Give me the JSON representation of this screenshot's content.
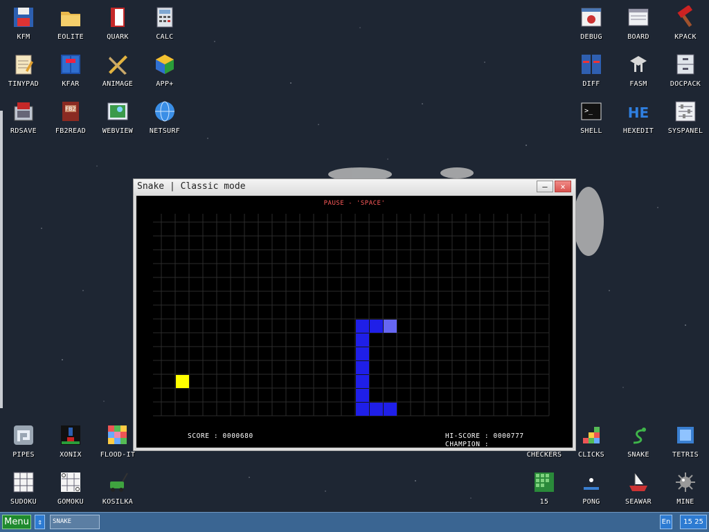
{
  "desktop": {
    "icons": [
      {
        "label": "KFM",
        "icon": "floppy-disk-icon"
      },
      {
        "label": "EOLITE",
        "icon": "folder-icon"
      },
      {
        "label": "QUARK",
        "icon": "red-book-icon"
      },
      {
        "label": "CALC",
        "icon": "calculator-icon"
      },
      {
        "label": "TINYPAD",
        "icon": "notepad-icon"
      },
      {
        "label": "KFAR",
        "icon": "file-manager-icon"
      },
      {
        "label": "ANIMAGE",
        "icon": "pencil-ruler-icon"
      },
      {
        "label": "APP+",
        "icon": "cube-icon"
      },
      {
        "label": "RDSAVE",
        "icon": "ramdisk-save-icon"
      },
      {
        "label": "FB2READ",
        "icon": "fb2-book-icon"
      },
      {
        "label": "WEBVIEW",
        "icon": "web-image-icon"
      },
      {
        "label": "NETSURF",
        "icon": "globe-icon"
      },
      {
        "label": "DEBUG",
        "icon": "bug-icon"
      },
      {
        "label": "BOARD",
        "icon": "board-window-icon"
      },
      {
        "label": "KPACK",
        "icon": "hammer-icon"
      },
      {
        "label": "DIFF",
        "icon": "diff-icon"
      },
      {
        "label": "FASM",
        "icon": "fasm-icon"
      },
      {
        "label": "DOCPACK",
        "icon": "drawer-icon"
      },
      {
        "label": "SHELL",
        "icon": "terminal-icon"
      },
      {
        "label": "HEXEDIT",
        "icon": "hex-editor-icon"
      },
      {
        "label": "SYSPANEL",
        "icon": "sliders-icon"
      },
      {
        "label": "PIPES",
        "icon": "pipes-icon"
      },
      {
        "label": "XONIX",
        "icon": "xonix-icon"
      },
      {
        "label": "FLOOD-IT",
        "icon": "color-grid-icon"
      },
      {
        "label": "SUDOKU",
        "icon": "sudoku-icon"
      },
      {
        "label": "GOMOKU",
        "icon": "tictactoe-icon"
      },
      {
        "label": "KOSILKA",
        "icon": "lawnmower-icon"
      },
      {
        "label": "CHECKERS",
        "icon": "checkers-icon"
      },
      {
        "label": "CLICKS",
        "icon": "blocks-icon"
      },
      {
        "label": "SNAKE",
        "icon": "snake-icon"
      },
      {
        "label": "TETRIS",
        "icon": "tetris-icon"
      },
      {
        "label": "15",
        "icon": "fifteen-puzzle-icon"
      },
      {
        "label": "PONG",
        "icon": "pong-icon"
      },
      {
        "label": "SEAWAR",
        "icon": "ship-icon"
      },
      {
        "label": "MINE",
        "icon": "mine-icon"
      }
    ]
  },
  "window": {
    "title": "Snake | Classic mode",
    "min_label": "–",
    "close_label": "×"
  },
  "game": {
    "pause_text": "PAUSE - 'SPACE'",
    "score_text": "SCORE : 0000680",
    "hiscore_text": "HI-SCORE : 0000777",
    "champion_text": "CHAMPION :",
    "grid_cols": 28,
    "grid_rows": 14,
    "snake_cells": [
      [
        14,
        7
      ],
      [
        15,
        7
      ],
      [
        14,
        8
      ],
      [
        14,
        9
      ],
      [
        14,
        10
      ],
      [
        14,
        11
      ],
      [
        14,
        12
      ],
      [
        14,
        13
      ],
      [
        15,
        13
      ],
      [
        16,
        13
      ]
    ],
    "snake_head": [
      16,
      7
    ],
    "food": [
      1,
      11
    ],
    "colors": {
      "snake": "#1f1fe8",
      "head": "#6666f2",
      "food": "#ffff00",
      "grid": "#2c2c2c"
    }
  },
  "taskbar": {
    "menu_label": "Menu",
    "switch_label": "⇕",
    "task_label": "SNAKE",
    "lang_label": "En",
    "clock": "15 25"
  }
}
